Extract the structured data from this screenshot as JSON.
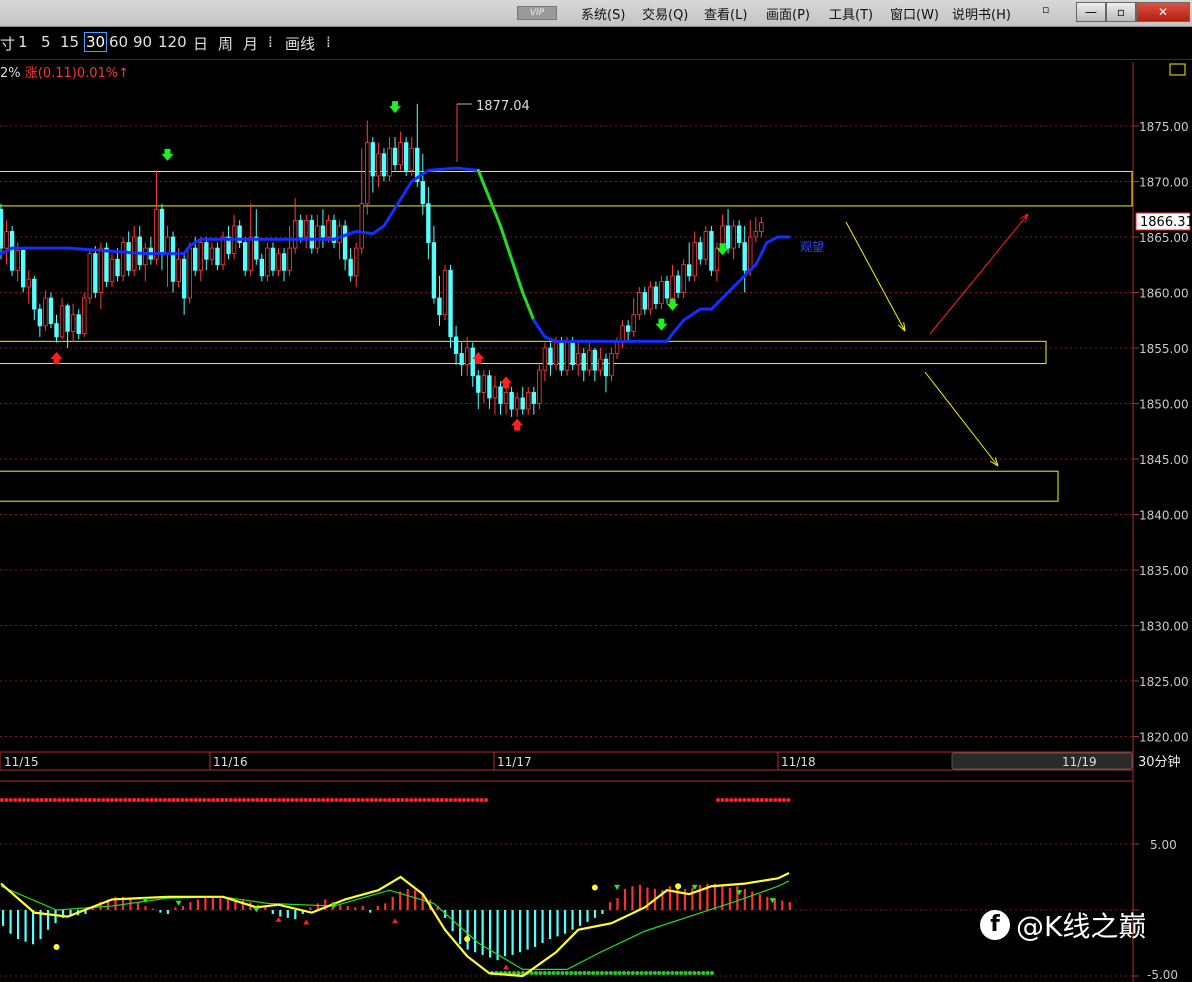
{
  "menubar": {
    "vip": "VIP",
    "items": [
      "系统(S)",
      "交易(Q)",
      "查看(L)",
      "画面(P)",
      "工具(T)",
      "窗口(W)",
      "说明书(H)"
    ],
    "close_glyph": "✕",
    "restore_glyph": "▫",
    "min_glyph": "—"
  },
  "toolbar": {
    "items": [
      "寸",
      "1",
      "5",
      "15",
      "30",
      "60",
      "90",
      "120",
      "日",
      "周",
      "月",
      "⁞",
      "画线",
      "⁞"
    ],
    "selected": "30"
  },
  "info": {
    "prefix": "2%",
    "change": "涨(0.11)0.01%↑",
    "change_color": "#ff3333"
  },
  "main_chart": {
    "high_label": "1877.04",
    "last_price": "1866.31",
    "watch_label": "观望",
    "y_ticks": [
      "1875.00",
      "1870.00",
      "1865.00",
      "1860.00",
      "1855.00",
      "1850.00",
      "1845.00",
      "1840.00",
      "1835.00",
      "1830.00",
      "1825.00",
      "1820.00"
    ],
    "date_labels": [
      "11/15",
      "11/16",
      "11/17",
      "11/18",
      "11/19"
    ],
    "period_label": "30分钟",
    "up_color": "#ff3c3c",
    "down_color": "#54ffff",
    "ma_color": "#1030ff",
    "ma_falling_color": "#22dd22",
    "zone_color": "#f5f500"
  },
  "indicator": {
    "y_ticks": [
      "5.00",
      "-5.00"
    ]
  },
  "watermark": {
    "logo": "f",
    "text": "@K线之巅"
  },
  "chart_data": {
    "type": "candlestick",
    "title": "",
    "period": "30分钟",
    "ylim": [
      1818,
      1883
    ],
    "y_ticks": [
      1875,
      1870,
      1865,
      1860,
      1855,
      1850,
      1845,
      1840,
      1835,
      1830,
      1825,
      1820
    ],
    "x": [
      "11/15",
      "11/16",
      "11/17",
      "11/18",
      "11/19"
    ],
    "annotations": {
      "high": 1877.04,
      "last": 1866.31,
      "zones": [
        [
          1870.9,
          1867.8
        ],
        [
          1855.6,
          1853.6
        ],
        [
          1843.9,
          1841.2
        ]
      ],
      "label": "观望"
    },
    "candles": [
      [
        1867.5,
        1864.0,
        1868.0,
        1863.0
      ],
      [
        1864.0,
        1865.5,
        1866.5,
        1862.5
      ],
      [
        1865.5,
        1862.0,
        1866.0,
        1861.5
      ],
      [
        1862.0,
        1863.8,
        1864.5,
        1861.0
      ],
      [
        1863.8,
        1860.5,
        1864.0,
        1860.0
      ],
      [
        1860.5,
        1861.2,
        1862.0,
        1859.0
      ],
      [
        1861.2,
        1858.5,
        1861.5,
        1857.5
      ],
      [
        1858.5,
        1857.0,
        1859.0,
        1856.0
      ],
      [
        1857.0,
        1859.5,
        1860.2,
        1856.5
      ],
      [
        1859.5,
        1857.2,
        1860.0,
        1856.8
      ],
      [
        1857.2,
        1856.0,
        1858.0,
        1855.5
      ],
      [
        1856.0,
        1858.8,
        1859.5,
        1855.8
      ],
      [
        1858.8,
        1856.5,
        1859.0,
        1855.0
      ],
      [
        1856.5,
        1858.0,
        1859.0,
        1855.5
      ],
      [
        1858.0,
        1856.3,
        1858.5,
        1855.8
      ],
      [
        1856.3,
        1859.5,
        1860.0,
        1856.0
      ],
      [
        1859.5,
        1863.5,
        1864.0,
        1859.0
      ],
      [
        1863.5,
        1860.0,
        1864.2,
        1859.5
      ],
      [
        1860.0,
        1864.0,
        1864.5,
        1858.5
      ],
      [
        1864.0,
        1861.0,
        1864.5,
        1860.5
      ],
      [
        1861.0,
        1863.0,
        1863.5,
        1860.5
      ],
      [
        1863.0,
        1861.5,
        1864.0,
        1861.0
      ],
      [
        1861.5,
        1864.5,
        1865.0,
        1861.0
      ],
      [
        1864.5,
        1862.0,
        1865.5,
        1861.5
      ],
      [
        1862.0,
        1865.0,
        1866.0,
        1861.5
      ],
      [
        1865.0,
        1862.5,
        1866.0,
        1862.0
      ],
      [
        1862.5,
        1864.0,
        1864.5,
        1861.0
      ],
      [
        1864.0,
        1863.0,
        1865.0,
        1862.5
      ],
      [
        1863.0,
        1867.5,
        1871.0,
        1862.5
      ],
      [
        1867.5,
        1863.5,
        1868.0,
        1862.0
      ],
      [
        1863.5,
        1865.0,
        1866.0,
        1860.5
      ],
      [
        1865.0,
        1861.0,
        1865.5,
        1860.0
      ],
      [
        1861.0,
        1863.0,
        1864.0,
        1860.5
      ],
      [
        1863.0,
        1859.5,
        1863.5,
        1858.0
      ],
      [
        1859.5,
        1864.0,
        1864.5,
        1859.0
      ],
      [
        1864.0,
        1862.0,
        1865.0,
        1861.5
      ],
      [
        1862.0,
        1864.5,
        1865.0,
        1861.0
      ],
      [
        1864.5,
        1863.0,
        1865.0,
        1862.0
      ],
      [
        1863.0,
        1864.0,
        1864.5,
        1862.5
      ],
      [
        1864.0,
        1862.5,
        1864.5,
        1862.0
      ],
      [
        1862.5,
        1865.0,
        1865.5,
        1862.0
      ],
      [
        1865.0,
        1863.5,
        1866.0,
        1863.0
      ],
      [
        1863.5,
        1866.0,
        1867.0,
        1863.0
      ],
      [
        1866.0,
        1864.5,
        1866.5,
        1864.0
      ],
      [
        1864.5,
        1862.0,
        1865.0,
        1861.5
      ],
      [
        1862.0,
        1865.0,
        1868.0,
        1861.5
      ],
      [
        1865.0,
        1863.0,
        1867.5,
        1862.5
      ],
      [
        1863.0,
        1861.5,
        1863.5,
        1861.0
      ],
      [
        1861.5,
        1864.0,
        1864.5,
        1861.0
      ],
      [
        1864.0,
        1862.0,
        1864.5,
        1861.5
      ],
      [
        1862.0,
        1863.5,
        1864.0,
        1861.5
      ],
      [
        1863.5,
        1862.0,
        1864.0,
        1861.0
      ],
      [
        1862.0,
        1864.0,
        1866.0,
        1861.5
      ],
      [
        1864.0,
        1866.5,
        1868.5,
        1863.5
      ],
      [
        1866.5,
        1865.0,
        1867.0,
        1864.5
      ],
      [
        1865.0,
        1866.5,
        1867.0,
        1864.0
      ],
      [
        1866.5,
        1864.0,
        1867.0,
        1863.5
      ],
      [
        1864.0,
        1866.0,
        1867.0,
        1863.5
      ],
      [
        1866.0,
        1865.0,
        1867.5,
        1864.0
      ],
      [
        1865.0,
        1866.5,
        1867.0,
        1864.5
      ],
      [
        1866.5,
        1864.5,
        1867.0,
        1864.0
      ],
      [
        1864.5,
        1866.0,
        1866.5,
        1863.0
      ],
      [
        1866.0,
        1863.0,
        1866.5,
        1862.0
      ],
      [
        1863.0,
        1861.5,
        1864.0,
        1861.0
      ],
      [
        1861.5,
        1864.0,
        1864.5,
        1860.5
      ],
      [
        1864.0,
        1868.0,
        1873.0,
        1863.5
      ],
      [
        1868.0,
        1873.5,
        1875.5,
        1867.0
      ],
      [
        1873.5,
        1870.5,
        1874.0,
        1869.0
      ],
      [
        1870.5,
        1872.5,
        1873.5,
        1869.5
      ],
      [
        1872.5,
        1870.5,
        1873.0,
        1870.0
      ],
      [
        1870.5,
        1873.0,
        1874.0,
        1870.0
      ],
      [
        1873.0,
        1871.5,
        1874.0,
        1871.0
      ],
      [
        1871.5,
        1873.5,
        1874.5,
        1871.0
      ],
      [
        1873.5,
        1871.0,
        1874.0,
        1870.5
      ],
      [
        1871.0,
        1873.0,
        1874.0,
        1870.5
      ],
      [
        1873.0,
        1870.0,
        1877.0,
        1869.5
      ],
      [
        1870.0,
        1868.0,
        1872.5,
        1867.0
      ],
      [
        1868.0,
        1864.5,
        1869.5,
        1863.0
      ],
      [
        1864.5,
        1859.5,
        1866.0,
        1859.0
      ],
      [
        1859.5,
        1858.0,
        1861.5,
        1857.0
      ],
      [
        1858.0,
        1862.0,
        1862.5,
        1857.5
      ],
      [
        1862.0,
        1856.0,
        1862.5,
        1855.0
      ],
      [
        1856.0,
        1854.5,
        1857.0,
        1853.5
      ],
      [
        1854.5,
        1853.5,
        1855.5,
        1852.5
      ],
      [
        1853.5,
        1855.0,
        1856.0,
        1852.5
      ],
      [
        1855.0,
        1852.5,
        1855.5,
        1851.5
      ],
      [
        1852.5,
        1851.0,
        1853.0,
        1849.5
      ],
      [
        1851.0,
        1852.5,
        1853.0,
        1850.0
      ],
      [
        1852.5,
        1850.5,
        1853.0,
        1849.5
      ],
      [
        1850.5,
        1851.5,
        1852.5,
        1849.0
      ],
      [
        1851.5,
        1850.0,
        1852.0,
        1849.0
      ],
      [
        1850.0,
        1851.0,
        1851.5,
        1849.0
      ],
      [
        1851.0,
        1849.5,
        1851.5,
        1848.8
      ],
      [
        1849.5,
        1850.5,
        1851.0,
        1848.8
      ],
      [
        1850.5,
        1849.5,
        1851.5,
        1849.0
      ],
      [
        1849.5,
        1851.0,
        1851.5,
        1849.0
      ],
      [
        1851.0,
        1850.0,
        1851.5,
        1849.0
      ],
      [
        1850.0,
        1853.0,
        1853.5,
        1849.5
      ],
      [
        1853.0,
        1855.0,
        1855.5,
        1852.0
      ],
      [
        1855.0,
        1853.5,
        1855.5,
        1852.5
      ],
      [
        1853.5,
        1855.5,
        1856.0,
        1853.0
      ],
      [
        1855.5,
        1853.0,
        1856.0,
        1852.5
      ],
      [
        1853.0,
        1855.5,
        1856.0,
        1852.5
      ],
      [
        1855.5,
        1853.5,
        1856.0,
        1853.0
      ],
      [
        1853.5,
        1854.5,
        1855.5,
        1852.5
      ],
      [
        1854.5,
        1853.0,
        1855.0,
        1852.0
      ],
      [
        1853.0,
        1854.8,
        1855.5,
        1852.5
      ],
      [
        1854.8,
        1853.0,
        1855.0,
        1852.0
      ],
      [
        1853.0,
        1854.0,
        1855.0,
        1852.5
      ],
      [
        1854.0,
        1852.5,
        1854.5,
        1851.0
      ],
      [
        1852.5,
        1854.5,
        1855.0,
        1852.0
      ],
      [
        1854.5,
        1855.5,
        1856.0,
        1854.0
      ],
      [
        1855.5,
        1857.0,
        1857.5,
        1855.0
      ],
      [
        1857.0,
        1856.5,
        1857.5,
        1855.5
      ],
      [
        1856.5,
        1858.0,
        1859.5,
        1856.0
      ],
      [
        1858.0,
        1860.0,
        1860.5,
        1857.5
      ],
      [
        1860.0,
        1858.5,
        1860.5,
        1858.0
      ],
      [
        1858.5,
        1860.5,
        1861.0,
        1858.0
      ],
      [
        1860.5,
        1859.0,
        1861.0,
        1858.5
      ],
      [
        1859.0,
        1861.0,
        1861.5,
        1858.5
      ],
      [
        1861.0,
        1859.5,
        1861.5,
        1859.0
      ],
      [
        1859.5,
        1861.5,
        1862.5,
        1859.0
      ],
      [
        1861.5,
        1860.0,
        1862.0,
        1859.5
      ],
      [
        1860.0,
        1862.5,
        1863.0,
        1859.5
      ],
      [
        1862.5,
        1861.5,
        1864.5,
        1861.0
      ],
      [
        1861.5,
        1864.5,
        1865.5,
        1861.0
      ],
      [
        1864.5,
        1863.0,
        1865.0,
        1862.5
      ],
      [
        1863.0,
        1865.5,
        1866.0,
        1862.5
      ],
      [
        1865.5,
        1862.0,
        1866.0,
        1861.5
      ],
      [
        1862.0,
        1864.0,
        1864.5,
        1861.0
      ],
      [
        1864.0,
        1866.0,
        1867.0,
        1863.5
      ],
      [
        1866.0,
        1864.0,
        1867.5,
        1863.5
      ],
      [
        1864.0,
        1866.0,
        1866.5,
        1863.0
      ],
      [
        1866.0,
        1864.5,
        1866.5,
        1864.0
      ],
      [
        1864.5,
        1862.0,
        1866.0,
        1860.0
      ],
      [
        1862.0,
        1865.0,
        1866.5,
        1861.5
      ],
      [
        1865.0,
        1865.5,
        1866.8,
        1864.5
      ],
      [
        1865.5,
        1866.3,
        1866.8,
        1865.0
      ]
    ],
    "ma": [
      [
        0,
        1863.5
      ],
      [
        2,
        1864.0
      ],
      [
        12,
        1864.0
      ],
      [
        26,
        1863.5
      ],
      [
        33,
        1863.5
      ],
      [
        34,
        1864.2
      ],
      [
        36,
        1864.8
      ],
      [
        50,
        1864.8
      ],
      [
        60,
        1864.8
      ],
      [
        64,
        1865.5
      ],
      [
        67,
        1865.3
      ],
      [
        69,
        1866.0
      ],
      [
        74,
        1870.0
      ],
      [
        77,
        1871.0
      ],
      [
        82,
        1871.2
      ],
      [
        86,
        1871.0
      ],
      [
        90,
        1866.0
      ],
      [
        94,
        1860.0
      ],
      [
        96,
        1857.5
      ],
      [
        98,
        1856.0
      ],
      [
        100,
        1855.6
      ],
      [
        104,
        1855.6
      ],
      [
        120,
        1855.6
      ],
      [
        121,
        1856.3
      ],
      [
        123,
        1857.5
      ],
      [
        126,
        1858.5
      ],
      [
        128,
        1858.5
      ],
      [
        130,
        1859.5
      ],
      [
        132,
        1860.5
      ],
      [
        134,
        1861.5
      ],
      [
        136,
        1862.5
      ],
      [
        138,
        1864.5
      ],
      [
        140,
        1865.0
      ],
      [
        142,
        1865.0
      ]
    ],
    "ma_falling": [
      86,
      96
    ],
    "indicator": {
      "ylim": [
        -6,
        8
      ],
      "dif": [
        [
          0,
          2.0
        ],
        [
          6,
          -0.2
        ],
        [
          12,
          -0.5
        ],
        [
          20,
          0.8
        ],
        [
          30,
          1.0
        ],
        [
          40,
          1.0
        ],
        [
          46,
          0.2
        ],
        [
          50,
          0.4
        ],
        [
          56,
          -0.2
        ],
        [
          62,
          0.8
        ],
        [
          68,
          1.5
        ],
        [
          72,
          2.5
        ],
        [
          76,
          1.2
        ],
        [
          80,
          -1.5
        ],
        [
          84,
          -3.5
        ],
        [
          88,
          -4.8
        ],
        [
          94,
          -5.0
        ],
        [
          100,
          -3.2
        ],
        [
          104,
          -1.5
        ],
        [
          110,
          -1.0
        ],
        [
          116,
          0.2
        ],
        [
          120,
          1.5
        ],
        [
          124,
          1.2
        ],
        [
          128,
          1.8
        ],
        [
          134,
          2.0
        ],
        [
          140,
          2.4
        ],
        [
          142,
          2.8
        ]
      ],
      "dea": [
        [
          0,
          1.8
        ],
        [
          10,
          0.0
        ],
        [
          20,
          0.3
        ],
        [
          30,
          0.9
        ],
        [
          40,
          1.0
        ],
        [
          48,
          0.5
        ],
        [
          60,
          0.3
        ],
        [
          70,
          1.5
        ],
        [
          78,
          0.5
        ],
        [
          86,
          -2.5
        ],
        [
          94,
          -4.5
        ],
        [
          102,
          -4.5
        ],
        [
          108,
          -3.2
        ],
        [
          116,
          -1.6
        ],
        [
          124,
          -0.5
        ],
        [
          132,
          0.6
        ],
        [
          140,
          1.8
        ],
        [
          142,
          2.2
        ]
      ],
      "hist": [
        -1.2,
        -1.8,
        -2.2,
        -2.4,
        -2.6,
        -2.2,
        -1.5,
        -1.0,
        -0.6,
        -0.5,
        -0.4,
        -0.3,
        0.2,
        0.6,
        0.8,
        1.0,
        1.0,
        0.9,
        0.6,
        0.3,
        0.1,
        -0.2,
        -0.3,
        0.2,
        0.3,
        0.6,
        0.8,
        0.9,
        1.0,
        0.9,
        0.8,
        0.7,
        0.8,
        0.6,
        0.4,
        0.3,
        -0.3,
        -0.5,
        -0.6,
        -0.7,
        -0.3,
        0.2,
        0.5,
        0.8,
        0.6,
        0.4,
        0.3,
        0.2,
        0.3,
        -0.2,
        0.3,
        0.5,
        1.0,
        1.4,
        1.6,
        1.5,
        1.2,
        0.8,
        0.3,
        -0.6,
        -1.6,
        -2.6,
        -3.0,
        -3.2,
        -3.4,
        -3.6,
        -3.8,
        -3.5,
        -3.4,
        -3.2,
        -3.0,
        -2.8,
        -2.5,
        -2.2,
        -2.0,
        -1.8,
        -1.5,
        -1.2,
        -0.9,
        -0.6,
        -0.3,
        0.6,
        0.9,
        1.6,
        1.8,
        1.9,
        1.7,
        1.6,
        1.5,
        1.8,
        1.6,
        1.6,
        1.7,
        1.9,
        2.0,
        2.0,
        1.8,
        1.7,
        1.8,
        1.6,
        1.4,
        1.2,
        1.0,
        0.9,
        0.7,
        0.6
      ]
    }
  }
}
